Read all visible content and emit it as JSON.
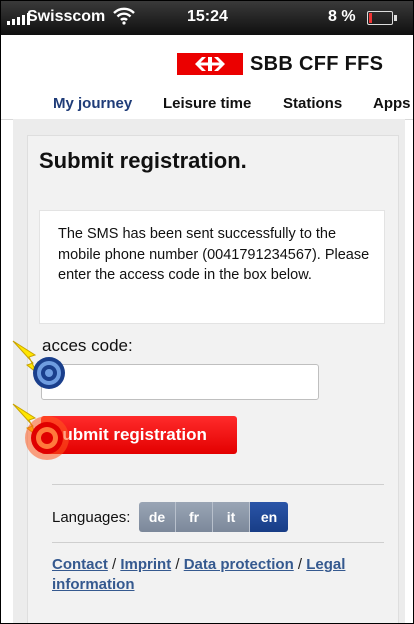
{
  "status_bar": {
    "carrier": "Swisscom",
    "time": "15:24",
    "battery": "8 %",
    "battery_level_percent": 8
  },
  "brand": {
    "logo_text": "SBB CFF FFS"
  },
  "nav": {
    "tabs": [
      {
        "label": "My journey",
        "active": true
      },
      {
        "label": "Leisure time",
        "active": false
      },
      {
        "label": "Stations",
        "active": false
      },
      {
        "label": "Apps",
        "active": false
      }
    ]
  },
  "page": {
    "title": "Submit registration.",
    "message": "The SMS has been sent successfully to the mobile phone number (0041791234567). Please enter the access code in the box below.",
    "access_code_label": "acces code:",
    "access_code_value": "",
    "submit_label": "Submit registration"
  },
  "languages": {
    "label": "Languages:",
    "options": [
      "de",
      "fr",
      "it",
      "en"
    ],
    "selected": "en"
  },
  "footer": {
    "contact": "Contact",
    "imprint": "Imprint",
    "data_protection": "Data protection",
    "legal": "Legal information",
    "separator": " / "
  },
  "colors": {
    "brand_red": "#eb0000",
    "nav_active": "#1f3c78",
    "lang_active": "#1e4593",
    "link": "#35598f"
  }
}
